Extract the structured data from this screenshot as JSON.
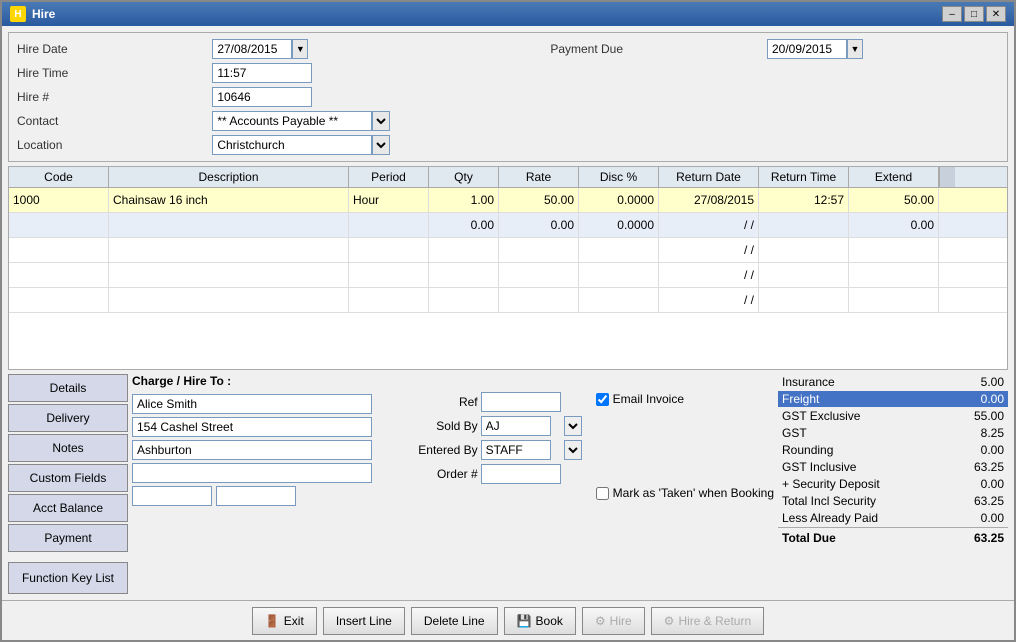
{
  "window": {
    "title": "Hire"
  },
  "header": {
    "hire_date_label": "Hire Date",
    "hire_date_value": "27/08/2015",
    "payment_due_label": "Payment Due",
    "payment_due_value": "20/09/2015",
    "hire_time_label": "Hire Time",
    "hire_time_value": "11:57",
    "hire_num_label": "Hire #",
    "hire_num_value": "10646",
    "contact_label": "Contact",
    "contact_value": "** Accounts Payable **",
    "location_label": "Location",
    "location_value": "Christchurch"
  },
  "grid": {
    "columns": [
      "Code",
      "Description",
      "Period",
      "Qty",
      "Rate",
      "Disc %",
      "Return Date",
      "Return Time",
      "Extend"
    ],
    "rows": [
      {
        "code": "1000",
        "description": "Chainsaw 16 inch",
        "period": "Hour",
        "qty": "1.00",
        "rate": "50.00",
        "disc": "0.0000",
        "return_date": "27/08/2015",
        "return_time": "12:57",
        "extend": "50.00",
        "type": "active"
      },
      {
        "code": "",
        "description": "",
        "period": "",
        "qty": "0.00",
        "rate": "0.00",
        "disc": "0.0000",
        "return_date": "/ /",
        "return_time": "",
        "extend": "0.00",
        "type": "alt"
      },
      {
        "code": "",
        "description": "",
        "period": "",
        "qty": "",
        "rate": "",
        "disc": "",
        "return_date": "/ /",
        "return_time": "",
        "extend": "",
        "type": "empty"
      },
      {
        "code": "",
        "description": "",
        "period": "",
        "qty": "",
        "rate": "",
        "disc": "",
        "return_date": "/ /",
        "return_time": "",
        "extend": "",
        "type": "empty"
      },
      {
        "code": "",
        "description": "",
        "period": "",
        "qty": "",
        "rate": "",
        "disc": "",
        "return_date": "/ /",
        "return_time": "",
        "extend": "",
        "type": "empty"
      },
      {
        "code": "",
        "description": "",
        "period": "",
        "qty": "",
        "rate": "",
        "disc": "",
        "return_date": "/ /",
        "return_time": "",
        "extend": "",
        "type": "empty"
      }
    ]
  },
  "sidebar": {
    "buttons": [
      "Details",
      "Delivery",
      "Notes",
      "Custom Fields",
      "Acct Balance",
      "Payment"
    ],
    "func_key": "Function Key List"
  },
  "charge_section": {
    "title": "Charge / Hire To :",
    "line1": "Alice Smith",
    "line2": "154 Cashel Street",
    "line3": "Ashburton",
    "line4": "",
    "ref_label": "Ref",
    "ref_value": "",
    "sold_by_label": "Sold By",
    "sold_by_value": "AJ",
    "entered_by_label": "Entered By",
    "entered_by_value": "STAFF",
    "order_label": "Order #",
    "order_value": "",
    "email_invoice_label": "Email Invoice",
    "mark_taken_label": "Mark as 'Taken' when Booking"
  },
  "totals": {
    "insurance_label": "Insurance",
    "insurance_value": "5.00",
    "freight_label": "Freight",
    "freight_value": "0.00",
    "gst_exclusive_label": "GST Exclusive",
    "gst_exclusive_value": "55.00",
    "gst_label": "GST",
    "gst_value": "8.25",
    "rounding_label": "Rounding",
    "rounding_value": "0.00",
    "gst_inclusive_label": "GST Inclusive",
    "gst_inclusive_value": "63.25",
    "security_deposit_label": "+ Security Deposit",
    "security_deposit_value": "0.00",
    "total_incl_security_label": "Total Incl Security",
    "total_incl_security_value": "63.25",
    "less_already_paid_label": "Less Already Paid",
    "less_already_paid_value": "0.00",
    "total_due_label": "Total Due",
    "total_due_value": "63.25"
  },
  "bottom_bar": {
    "exit_label": "Exit",
    "insert_line_label": "Insert Line",
    "delete_line_label": "Delete Line",
    "book_label": "Book",
    "hire_label": "Hire",
    "hire_return_label": "Hire & Return"
  }
}
